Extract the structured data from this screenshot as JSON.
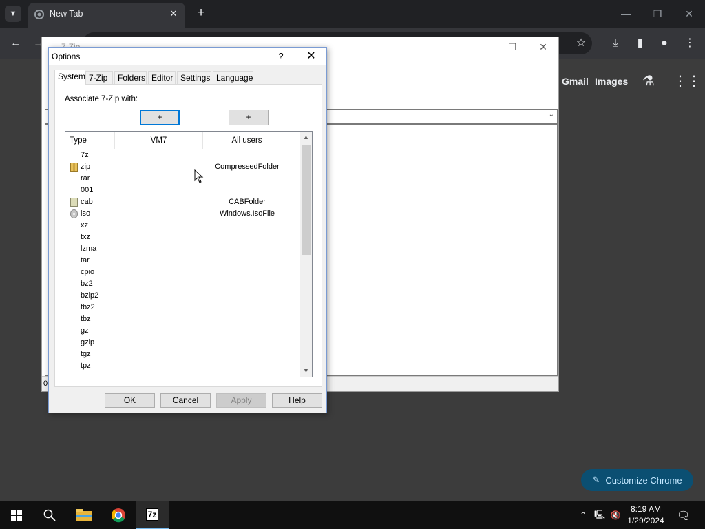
{
  "browser": {
    "tab_title": "New Tab",
    "ntp_links": [
      "Gmail",
      "Images"
    ],
    "customize_label": "Customize Chrome"
  },
  "file_manager": {
    "title": "7-Zip",
    "status_text": "0"
  },
  "dialog": {
    "title": "Options",
    "help_glyph": "?",
    "close_glyph": "✕",
    "tabs": [
      "System",
      "7-Zip",
      "Folders",
      "Editor",
      "Settings",
      "Language"
    ],
    "active_tab": "System",
    "associate_label": "Associate 7-Zip with:",
    "assoc_buttons": [
      "+",
      "+"
    ],
    "columns": [
      "Type",
      "VM7",
      "All users"
    ],
    "rows": [
      {
        "ext": "7z",
        "vm7": "",
        "all": "",
        "icon": ""
      },
      {
        "ext": "zip",
        "vm7": "",
        "all": "CompressedFolder",
        "icon": "zip-file-icon"
      },
      {
        "ext": "rar",
        "vm7": "",
        "all": "",
        "icon": ""
      },
      {
        "ext": "001",
        "vm7": "",
        "all": "",
        "icon": ""
      },
      {
        "ext": "cab",
        "vm7": "",
        "all": "CABFolder",
        "icon": "cab-file-icon"
      },
      {
        "ext": "iso",
        "vm7": "",
        "all": "Windows.IsoFile",
        "icon": "disc-image-icon"
      },
      {
        "ext": "xz",
        "vm7": "",
        "all": "",
        "icon": ""
      },
      {
        "ext": "txz",
        "vm7": "",
        "all": "",
        "icon": ""
      },
      {
        "ext": "lzma",
        "vm7": "",
        "all": "",
        "icon": ""
      },
      {
        "ext": "tar",
        "vm7": "",
        "all": "",
        "icon": ""
      },
      {
        "ext": "cpio",
        "vm7": "",
        "all": "",
        "icon": ""
      },
      {
        "ext": "bz2",
        "vm7": "",
        "all": "",
        "icon": ""
      },
      {
        "ext": "bzip2",
        "vm7": "",
        "all": "",
        "icon": ""
      },
      {
        "ext": "tbz2",
        "vm7": "",
        "all": "",
        "icon": ""
      },
      {
        "ext": "tbz",
        "vm7": "",
        "all": "",
        "icon": ""
      },
      {
        "ext": "gz",
        "vm7": "",
        "all": "",
        "icon": ""
      },
      {
        "ext": "gzip",
        "vm7": "",
        "all": "",
        "icon": ""
      },
      {
        "ext": "tgz",
        "vm7": "",
        "all": "",
        "icon": ""
      },
      {
        "ext": "tpz",
        "vm7": "",
        "all": "",
        "icon": ""
      }
    ],
    "buttons": {
      "ok": "OK",
      "cancel": "Cancel",
      "apply": "Apply",
      "help": "Help"
    }
  },
  "taskbar": {
    "time": "8:19 AM",
    "date": "1/29/2024",
    "active_app": "7-Zip",
    "sevenzip_label": "7z",
    "notification_count": "1"
  }
}
